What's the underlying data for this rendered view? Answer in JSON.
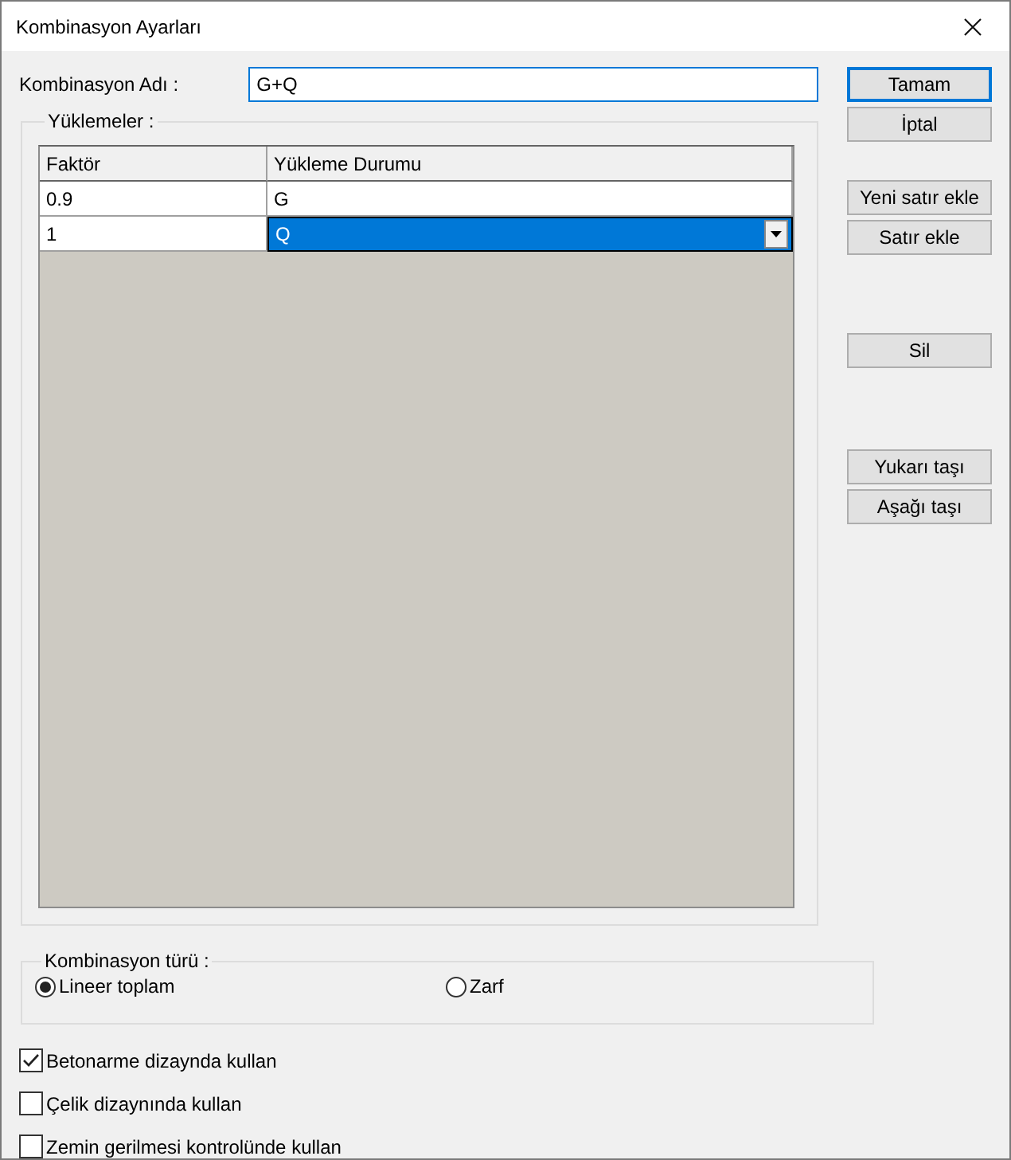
{
  "window": {
    "title": "Kombinasyon Ayarları"
  },
  "name_field": {
    "label": "Kombinasyon Adı :",
    "value": "G+Q"
  },
  "loads": {
    "legend": "Yüklemeler :",
    "columns": [
      "Faktör",
      "Yükleme Durumu"
    ],
    "rows": [
      {
        "cells": [
          "0.9",
          "G"
        ],
        "selected": false
      },
      {
        "cells": [
          "1",
          "Q"
        ],
        "selected": true
      }
    ]
  },
  "combination_type": {
    "legend": "Kombinasyon türü :",
    "options": [
      {
        "label": "Lineer toplam",
        "selected": true
      },
      {
        "label": "Zarf",
        "selected": false
      }
    ]
  },
  "checkboxes": [
    {
      "label": "Betonarme dizaynda kullan",
      "checked": true
    },
    {
      "label": "Çelik dizaynında kullan",
      "checked": false
    },
    {
      "label": "Zemin gerilmesi kontrolünde kullan",
      "checked": false
    }
  ],
  "button_groups": [
    [
      {
        "label": "Tamam",
        "default": true
      },
      {
        "label": "İptal",
        "default": false
      }
    ],
    [
      {
        "label": "Yeni satır ekle",
        "default": false
      },
      {
        "label": "Satır ekle",
        "default": false
      }
    ],
    [
      {
        "label": "Sil",
        "default": false
      }
    ],
    [
      {
        "label": "Yukarı taşı",
        "default": false
      },
      {
        "label": "Aşağı taşı",
        "default": false
      }
    ]
  ]
}
